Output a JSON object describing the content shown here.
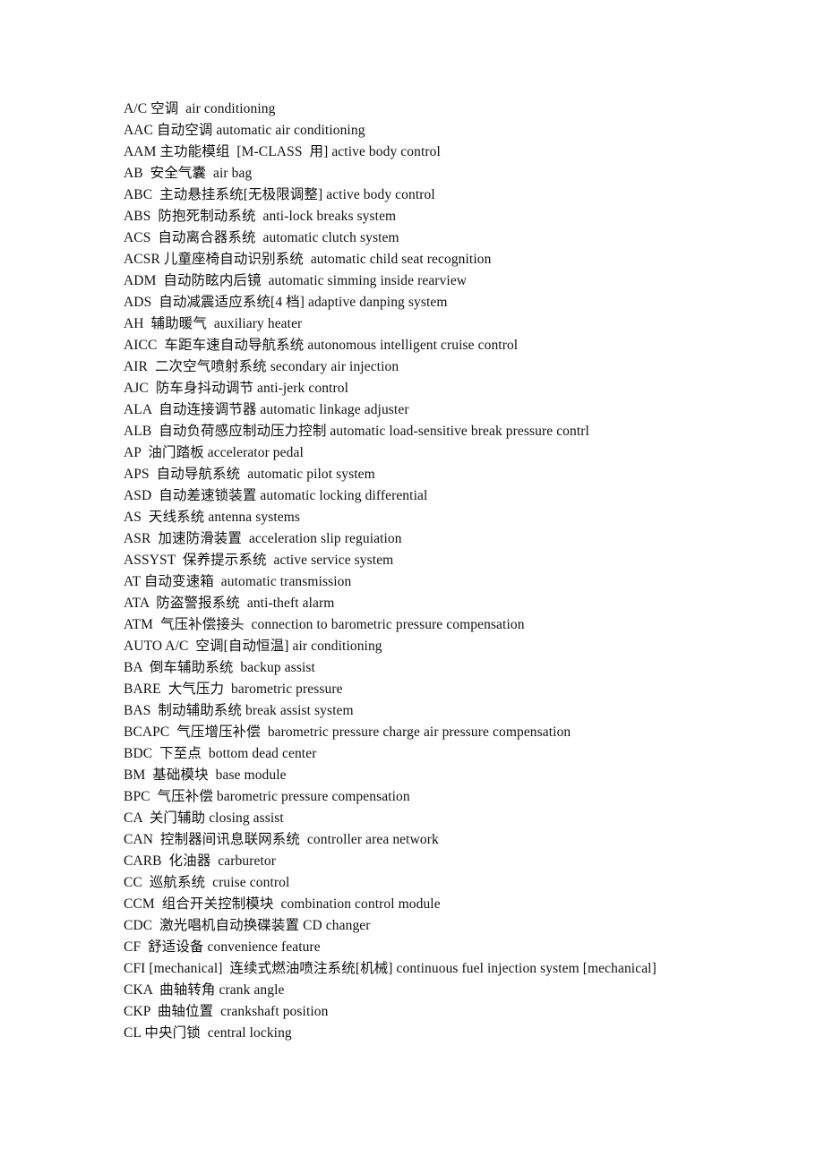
{
  "document": {
    "kind": "glossary-page",
    "page_background": "#ffffff",
    "text_color": "#111111",
    "script_mix": "Chinese-English",
    "entry_count": 44,
    "entries": [
      {
        "text": "A/C 空调  air conditioning"
      },
      {
        "text": "AAC 自动空调 automatic air conditioning"
      },
      {
        "text": "AAM 主功能模组  [M-CLASS  用] active body control"
      },
      {
        "text": "AB  安全气囊  air bag"
      },
      {
        "text": "ABC  主动悬挂系统[无极限调整] active body control"
      },
      {
        "text": "ABS  防抱死制动系统  anti-lock breaks system"
      },
      {
        "text": "ACS  自动离合器系统  automatic clutch system"
      },
      {
        "text": "ACSR 儿童座椅自动识别系统  automatic child seat recognition"
      },
      {
        "text": "ADM  自动防眩内后镜  automatic simming inside rearview"
      },
      {
        "text": "ADS  自动减震适应系统[4 档] adaptive danping system"
      },
      {
        "text": "AH  辅助暖气  auxiliary heater"
      },
      {
        "text": "AICC  车距车速自动导航系统 autonomous intelligent cruise control"
      },
      {
        "text": "AIR  二次空气喷射系统 secondary air injection"
      },
      {
        "text": "AJC  防车身抖动调节 anti-jerk control"
      },
      {
        "text": "ALA  自动连接调节器 automatic linkage adjuster"
      },
      {
        "text": "ALB  自动负荷感应制动压力控制 automatic load-sensitive break pressure contrl"
      },
      {
        "text": "AP  油门踏板 accelerator pedal"
      },
      {
        "text": "APS  自动导航系统  automatic pilot system"
      },
      {
        "text": "ASD  自动差速锁装置 automatic locking differential"
      },
      {
        "text": "AS  天线系统 antenna systems"
      },
      {
        "text": "ASR  加速防滑装置  acceleration slip reguiation"
      },
      {
        "text": "ASSYST  保养提示系统  active service system"
      },
      {
        "text": "AT 自动变速箱  automatic transmission"
      },
      {
        "text": "ATA  防盗警报系统  anti-theft alarm"
      },
      {
        "text": "ATM  气压补偿接头  connection to barometric pressure compensation"
      },
      {
        "text": "AUTO A/C  空调[自动恒温] air conditioning"
      },
      {
        "text": "BA  倒车辅助系统  backup assist"
      },
      {
        "text": "BARE  大气压力  barometric pressure"
      },
      {
        "text": "BAS  制动辅助系统 break assist system"
      },
      {
        "text": "BCAPC  气压增压补偿  barometric pressure charge air pressure compensation"
      },
      {
        "text": "BDC  下至点  bottom dead center"
      },
      {
        "text": "BM  基础模块  base module"
      },
      {
        "text": "BPC  气压补偿 barometric pressure compensation"
      },
      {
        "text": "CA  关门辅助 closing assist"
      },
      {
        "text": "CAN  控制器间讯息联网系统  controller area network"
      },
      {
        "text": "CARB  化油器  carburetor"
      },
      {
        "text": "CC  巡航系统  cruise control"
      },
      {
        "text": "CCM  组合开关控制模块  combination control module"
      },
      {
        "text": "CDC  激光唱机自动换碟装置 CD changer"
      },
      {
        "text": "CF  舒适设备 convenience feature"
      },
      {
        "text": "CFI [mechanical]  连续式燃油喷注系统[机械] continuous fuel injection system [mechanical]"
      },
      {
        "text": "CKA  曲轴转角 crank angle"
      },
      {
        "text": "CKP  曲轴位置  crankshaft position"
      },
      {
        "text": "CL 中央门锁  central locking"
      }
    ]
  }
}
